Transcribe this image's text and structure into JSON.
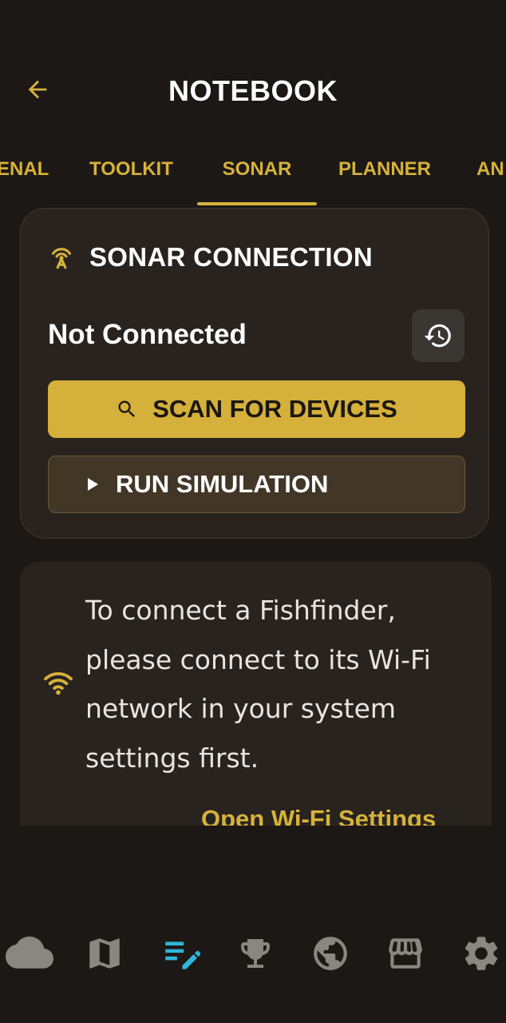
{
  "header": {
    "title": "NOTEBOOK",
    "back_icon": "arrow-left-icon"
  },
  "tabs": [
    {
      "label": "ARSENAL",
      "visible_label": "ENAL"
    },
    {
      "label": "TOOLKIT"
    },
    {
      "label": "SONAR",
      "selected": true
    },
    {
      "label": "PLANNER"
    },
    {
      "label": "AN"
    }
  ],
  "sonar_card": {
    "title": "SONAR CONNECTION",
    "icon": "sonar-antenna-icon",
    "status": "Not Connected",
    "history_icon": "history-icon",
    "scan_button": {
      "label": "SCAN FOR DEVICES",
      "icon": "search-icon"
    },
    "sim_button": {
      "label": "RUN SIMULATION",
      "icon": "play-icon"
    }
  },
  "info_card": {
    "icon": "wifi-icon",
    "message": "To connect a Fishfinder, please connect to its Wi-Fi network in your system settings first.",
    "link": "Open Wi-Fi Settings"
  },
  "bottom_nav": [
    {
      "name": "weather",
      "icon": "cloud-icon"
    },
    {
      "name": "map",
      "icon": "map-icon"
    },
    {
      "name": "notebook",
      "icon": "edit-notes-icon",
      "active": true
    },
    {
      "name": "trophies",
      "icon": "trophy-icon"
    },
    {
      "name": "community",
      "icon": "globe-icon"
    },
    {
      "name": "store",
      "icon": "store-icon"
    },
    {
      "name": "settings",
      "icon": "gear-icon"
    }
  ],
  "colors": {
    "background": "#1c1816",
    "card": "#28231f",
    "accent": "#d6b23a",
    "nav_active": "#2fb6d8",
    "nav_inactive": "#8a8682"
  }
}
